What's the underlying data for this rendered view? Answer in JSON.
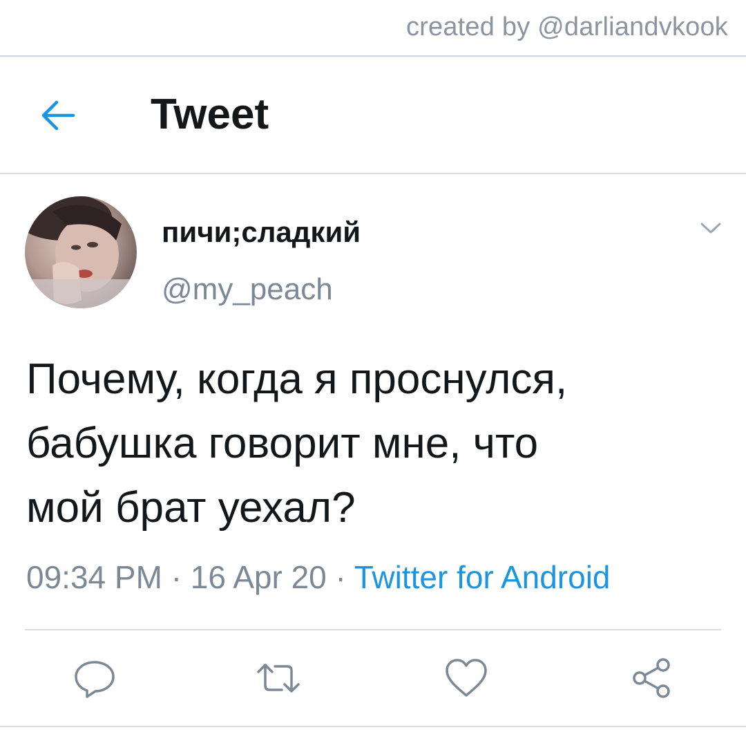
{
  "watermark": "created by @darliandvkook",
  "header": {
    "title": "Tweet",
    "back_icon": "arrow-left-icon"
  },
  "tweet": {
    "author": {
      "display_name": "пичи;сладкий",
      "handle": "@my_peach"
    },
    "text_lines": [
      "Почему, когда я проснулся,",
      "бабушка говорит мне, что",
      "мой брат уехал?"
    ],
    "time": "09:34 PM",
    "date": "16 Apr 20",
    "separator": "·",
    "source": "Twitter for Android"
  },
  "actions": [
    {
      "icon": "reply-icon"
    },
    {
      "icon": "retweet-icon"
    },
    {
      "icon": "like-icon"
    },
    {
      "icon": "share-icon"
    }
  ],
  "colors": {
    "accent": "#1b95e0",
    "text": "#14171a",
    "secondary": "#7b8895",
    "divider": "#d4dde5"
  }
}
